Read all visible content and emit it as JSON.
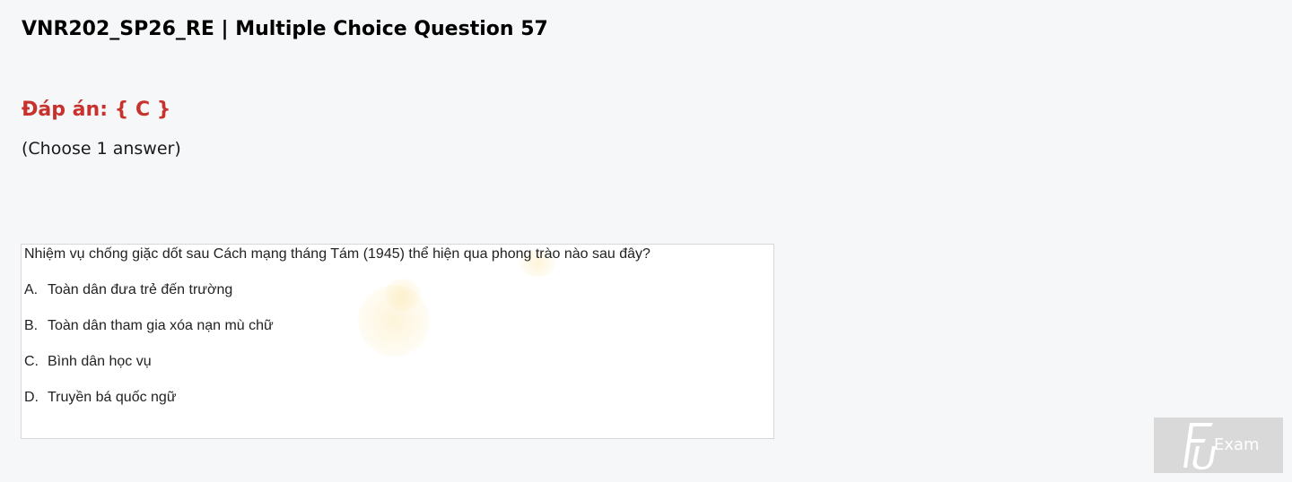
{
  "header": {
    "title": "VNR202_SP26_RE | Multiple Choice Question 57"
  },
  "answer": {
    "label": "Đáp án: { C }",
    "color": "#c8322c"
  },
  "instruction": "(Choose 1 answer)",
  "question": {
    "text": "Nhiệm vụ chống giặc dốt sau Cách mạng tháng Tám (1945) thể hiện qua phong trào nào sau đây?",
    "options": [
      {
        "letter": "A.",
        "text": "Toàn dân đưa trẻ đến trường"
      },
      {
        "letter": "B.",
        "text": "Toàn dân tham gia xóa nạn mù chữ"
      },
      {
        "letter": "C.",
        "text": "Bình dân học vụ"
      },
      {
        "letter": "D.",
        "text": "Truyền bá quốc ngữ"
      }
    ]
  },
  "logo": {
    "text": "Exam",
    "icon": "fu-logo-icon"
  }
}
